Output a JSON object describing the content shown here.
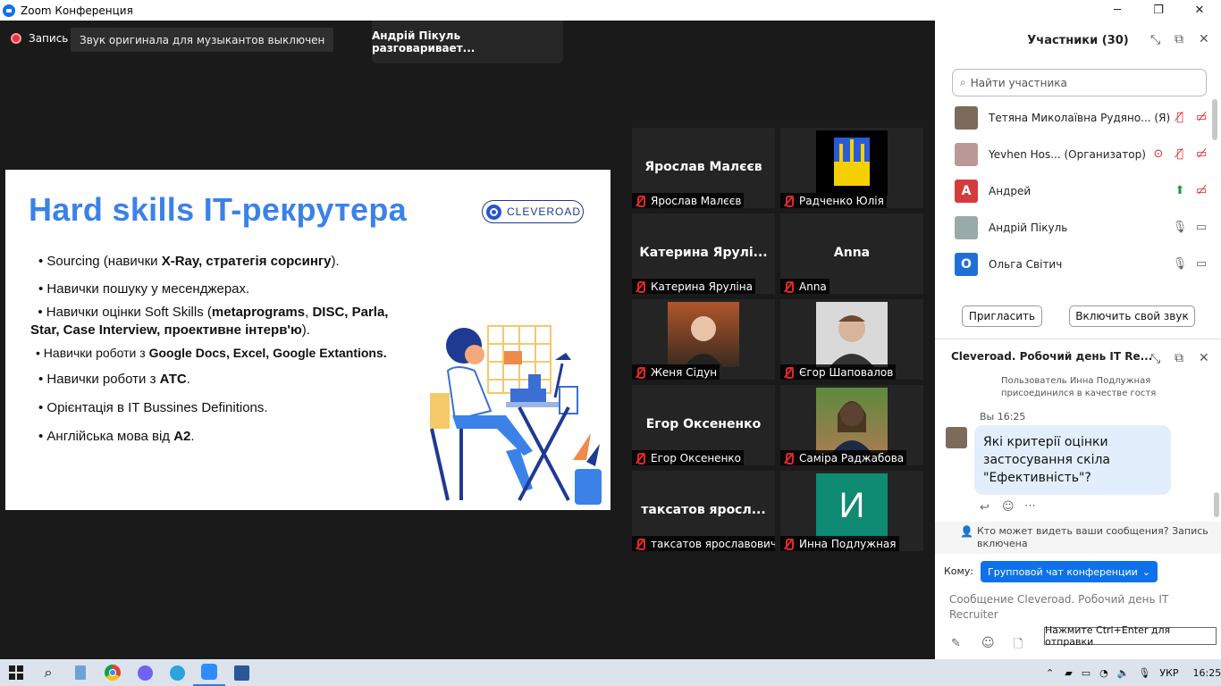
{
  "window": {
    "title": "Zoom Конференция",
    "min": "─",
    "restore": "❐",
    "close": "✕"
  },
  "top": {
    "recording": "Запись",
    "original_sound": "Звук оригинала для музыкантов выключен",
    "speaking": "Андрій Пікуль разговариваeт..."
  },
  "slide": {
    "title": "Hard skills IT-рекрутера",
    "logo": "CLEVEROAD",
    "b1": {
      "a": "Sourcing (навички ",
      "b": "X-Ray, стратегія сорсингу",
      "c": ")."
    },
    "b2": "Навички пошуку у месенджерах.",
    "b3": {
      "a": "Навички оцінки Soft Skills (",
      "b": "metaprograms",
      "c": ", ",
      "d": "DISC, Parla,",
      "e": "Star, Case Interview, проективне інтерв'ю",
      "f": ")."
    },
    "b4": {
      "a": "Навички роботи з ",
      "b": "Google Docs, Excel, Google Extantions."
    },
    "b5": {
      "a": "Навички роботи з ",
      "b": "АТС",
      "c": "."
    },
    "b6": "Орієнтація в IT Bussines Definitions.",
    "b7": {
      "a": "Англійська мова від ",
      "b": "А2",
      "c": "."
    }
  },
  "tiles": [
    {
      "big": "Ярослав Малєєв",
      "label": "Ярослав Малєєв"
    },
    {
      "big": "",
      "label": "Радченко Юлія"
    },
    {
      "big": "Катерина  Ярулі...",
      "label": "Катерина Яруліна"
    },
    {
      "big": "Anna",
      "label": "Anna"
    },
    {
      "big": "",
      "label": "Женя Сідун"
    },
    {
      "big": "",
      "label": "Єгор Шаповалов"
    },
    {
      "big": "Егор Оксененко",
      "label": "Егор Оксененко"
    },
    {
      "big": "",
      "label": "Саміра Раджабова"
    },
    {
      "big": "таксатов  яросл...",
      "label": "таксатов ярославович"
    },
    {
      "big": "",
      "label": "Инна Подлужная",
      "avatar_letter": "И"
    }
  ],
  "participants": {
    "title": "Участники (30)",
    "search_placeholder": "Найти участника",
    "list": [
      {
        "name": "Тетяна Миколаївна Рудяно... (Я)",
        "avatar": ""
      },
      {
        "name": "Yevhen Hos... (Организатор)",
        "avatar": ""
      },
      {
        "name": "Андрей",
        "avatar": "A"
      },
      {
        "name": "Андрій Пікуль",
        "avatar": ""
      },
      {
        "name": "Ольга Світич",
        "avatar": "O"
      }
    ],
    "invite": "Пригласить",
    "unmute": "Включить свой звук"
  },
  "chat": {
    "title": "Cleveroad. Робочий день IT Re...",
    "system_msg": "Пользователь Инна Подлужная присоединился в качестве гостя",
    "sender": "Вы 16:25",
    "message": "Які критерії оцінки застосування скіла \"Ефективність\"?",
    "visibility": "Кто может видеть ваши сообщения? Запись включена",
    "to_label": "Кому:",
    "to_value": "Групповой чат конференции",
    "input_placeholder": "Сообщение Cleveroad. Робочий день IT Recruiter",
    "hint": "Нажмите Ctrl+Enter для отправки"
  },
  "taskbar": {
    "lang": "УКР",
    "time": "16:25"
  },
  "colors": {
    "accent": "#0e71eb",
    "mute_red": "#e02828",
    "slide_title": "#3b82e8"
  }
}
